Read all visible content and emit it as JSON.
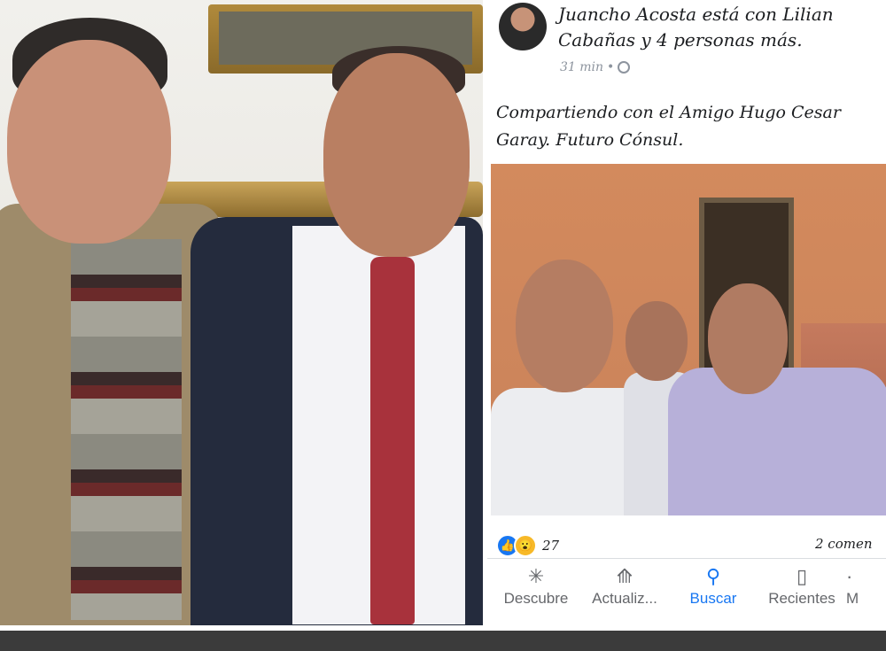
{
  "post": {
    "author_line": "Juancho Acosta está con Lilian Cabañas y 4 personas más.",
    "time": "31 min",
    "text_line1": "Compartiendo con el Amigo Hugo Cesar",
    "text_line2": "Garay.  Futuro Cónsul.",
    "reaction_count": "27",
    "comments": "2 comen"
  },
  "icons": {
    "like": "like-icon",
    "wow": "wow-icon",
    "globe": "globe-icon"
  },
  "tabs": [
    {
      "label": "Descubre",
      "icon": "✳"
    },
    {
      "label": "Actualiz...",
      "icon": "⟰"
    },
    {
      "label": "Buscar",
      "icon": "⚲"
    },
    {
      "label": "Recientes",
      "icon": "▯"
    },
    {
      "label": "M",
      "icon": "·"
    }
  ],
  "colors": {
    "accent": "#1877f2",
    "tie": "#a8323c"
  }
}
